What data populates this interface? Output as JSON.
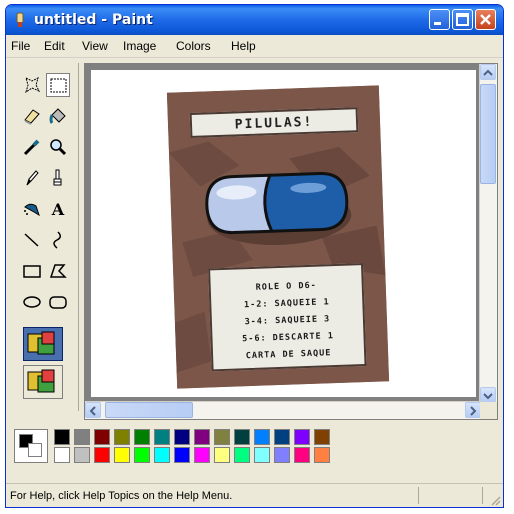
{
  "window": {
    "title": "untitled - Paint",
    "app_icon": "paint-app-icon",
    "controls": [
      "minimize-icon",
      "maximize-icon",
      "close-icon"
    ]
  },
  "menu": {
    "items": [
      "File",
      "Edit",
      "View",
      "Image",
      "Colors",
      "Help"
    ]
  },
  "toolbox": {
    "tools": [
      {
        "name": "free-form-select-icon"
      },
      {
        "name": "rectangle-select-icon",
        "selected": true
      },
      {
        "name": "eraser-icon"
      },
      {
        "name": "fill-bucket-icon"
      },
      {
        "name": "pick-color-icon"
      },
      {
        "name": "magnifier-icon"
      },
      {
        "name": "pencil-icon"
      },
      {
        "name": "brush-icon"
      },
      {
        "name": "airbrush-icon"
      },
      {
        "name": "text-icon",
        "glyph": "A"
      },
      {
        "name": "line-icon"
      },
      {
        "name": "curve-icon"
      },
      {
        "name": "rectangle-icon"
      },
      {
        "name": "polygon-icon"
      },
      {
        "name": "ellipse-icon"
      },
      {
        "name": "rounded-rectangle-icon"
      }
    ],
    "options": [
      "opaque-background-option-icon",
      "transparent-background-option-icon"
    ]
  },
  "canvas": {
    "card": {
      "title": "PILULAS!",
      "text_lines": [
        "ROLE O D6-",
        "1-2: SAQUEIE 1",
        "3-4: SAQUEIE 3",
        "5-6: DESCARTE 1",
        "CARTA DE SAQUE"
      ]
    }
  },
  "palette": {
    "foreground": "#000000",
    "background": "#ffffff",
    "row1": [
      "#000000",
      "#808080",
      "#800000",
      "#808000",
      "#008000",
      "#008080",
      "#000080",
      "#800080",
      "#808040",
      "#004040",
      "#0080ff",
      "#004080",
      "#8000ff",
      "#804000"
    ],
    "row2": [
      "#ffffff",
      "#c0c0c0",
      "#ff0000",
      "#ffff00",
      "#00ff00",
      "#00ffff",
      "#0000ff",
      "#ff00ff",
      "#ffff80",
      "#00ff80",
      "#80ffff",
      "#8080ff",
      "#ff0080",
      "#ff8040"
    ]
  },
  "status": {
    "text": "For Help, click Help Topics on the Help Menu."
  }
}
